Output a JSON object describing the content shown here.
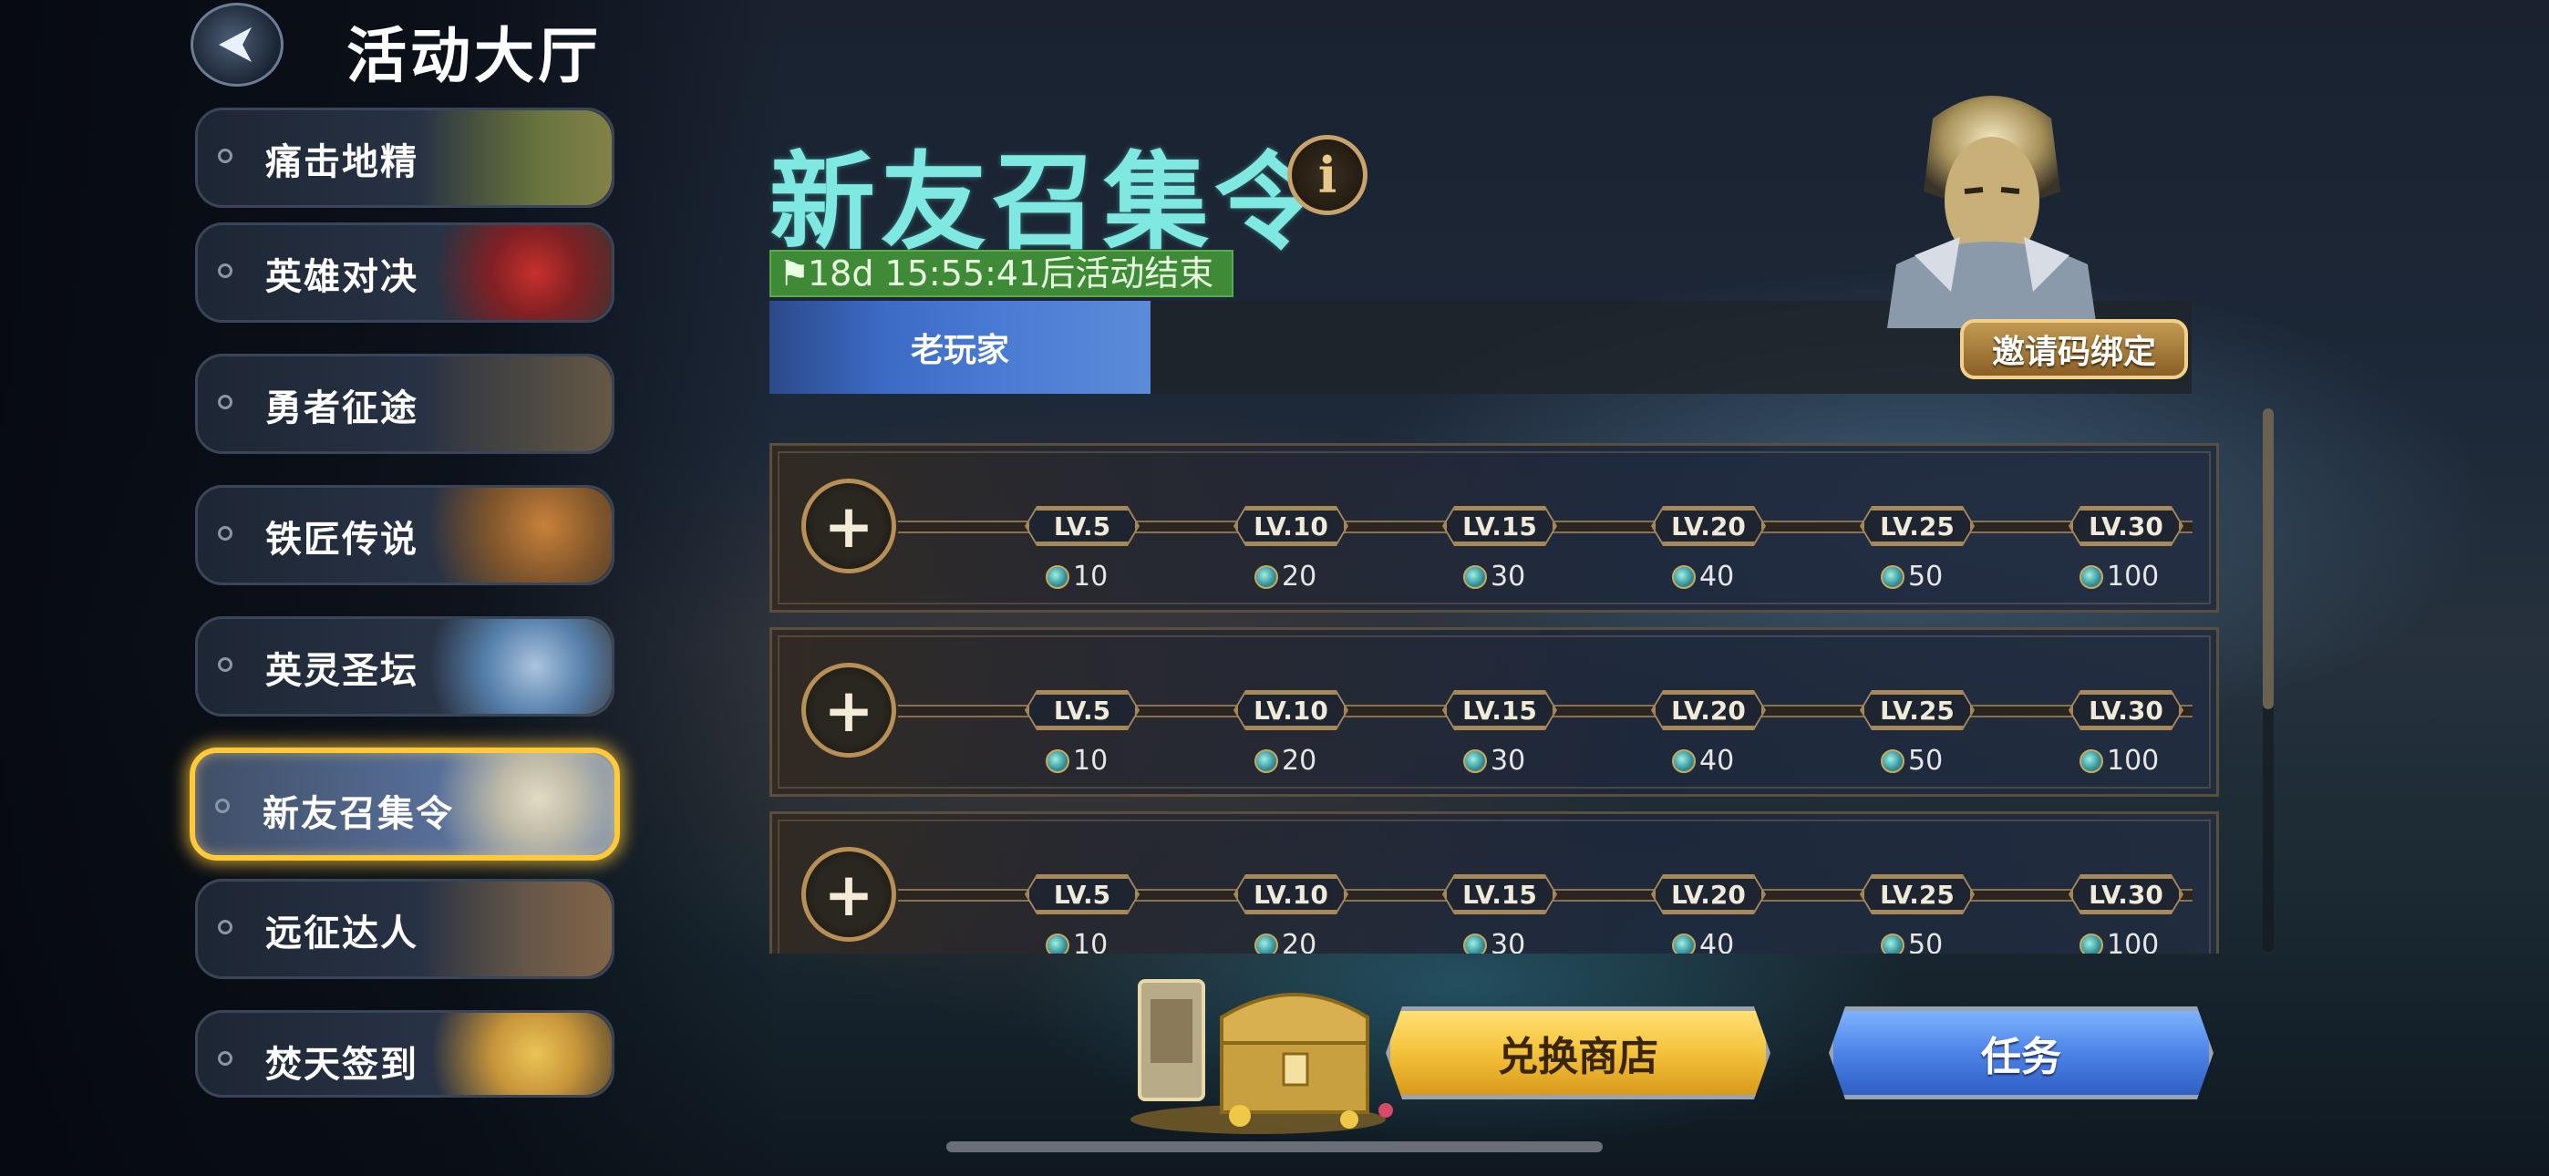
{
  "header": {
    "title": "活动大厅",
    "back_icon": "back-arrow-icon"
  },
  "sidebar": {
    "items": [
      {
        "label": "痛击地精",
        "active": false,
        "art_color": "#6b7a3e"
      },
      {
        "label": "英雄对决",
        "active": false,
        "art_color": "#8a1e22"
      },
      {
        "label": "勇者征途",
        "active": false,
        "art_color": "#4d4a44"
      },
      {
        "label": "铁匠传说",
        "active": false,
        "art_color": "#8a5a2a"
      },
      {
        "label": "英灵圣坛",
        "active": false,
        "art_color": "#5a88b8"
      },
      {
        "label": "新友召集令",
        "active": true,
        "art_color": "#c9c2a8"
      },
      {
        "label": "远征达人",
        "active": false,
        "art_color": "#6a5a4a"
      },
      {
        "label": "焚天签到",
        "active": false,
        "art_color": "#d8a03a"
      }
    ]
  },
  "event": {
    "title": "新友召集令",
    "info_icon": "info-icon",
    "timer_text": "18d 15:55:41后活动结束",
    "tab_label": "老玩家",
    "bind_button": "邀请码绑定"
  },
  "slots": [
    {
      "milestones": [
        {
          "level": "LV.5",
          "reward": "10"
        },
        {
          "level": "LV.10",
          "reward": "20"
        },
        {
          "level": "LV.15",
          "reward": "30"
        },
        {
          "level": "LV.20",
          "reward": "40"
        },
        {
          "level": "LV.25",
          "reward": "50"
        },
        {
          "level": "LV.30",
          "reward": "100"
        }
      ]
    },
    {
      "milestones": [
        {
          "level": "LV.5",
          "reward": "10"
        },
        {
          "level": "LV.10",
          "reward": "20"
        },
        {
          "level": "LV.15",
          "reward": "30"
        },
        {
          "level": "LV.20",
          "reward": "40"
        },
        {
          "level": "LV.25",
          "reward": "50"
        },
        {
          "level": "LV.30",
          "reward": "100"
        }
      ]
    },
    {
      "milestones": [
        {
          "level": "LV.5",
          "reward": "10"
        },
        {
          "level": "LV.10",
          "reward": "20"
        },
        {
          "level": "LV.15",
          "reward": "30"
        },
        {
          "level": "LV.20",
          "reward": "40"
        },
        {
          "level": "LV.25",
          "reward": "50"
        },
        {
          "level": "LV.30",
          "reward": "100"
        }
      ]
    }
  ],
  "footer": {
    "shop_button": "兑换商店",
    "task_button": "任务"
  },
  "colors": {
    "title_accent": "#7fe8e0",
    "active_border": "#ffc93a",
    "timer_bg": "#3f8a36",
    "shop_gold": "#f4c23a",
    "task_blue": "#4d83e6"
  }
}
